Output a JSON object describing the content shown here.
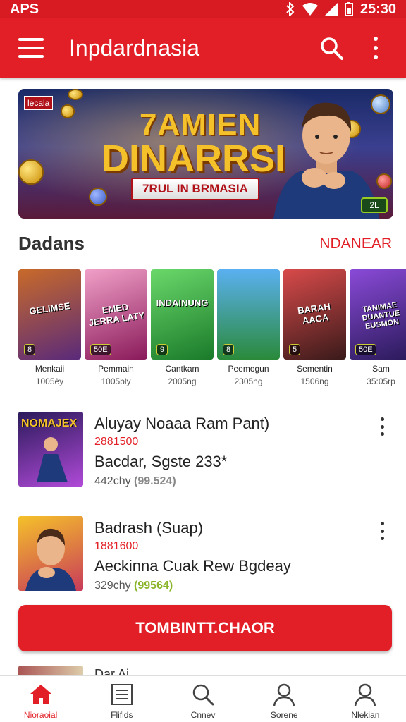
{
  "status_bar": {
    "left_text": "APS",
    "time": "25:30"
  },
  "app_bar": {
    "title": "Inpdardnasia"
  },
  "banner": {
    "tag": "lecala",
    "line1": "7AMIEN",
    "line2": "DINARRSI",
    "ribbon": "7RUL IN BRMASIA",
    "badge": "2L"
  },
  "section": {
    "heading": "Dadans",
    "link": "NDANEAR"
  },
  "cards": [
    {
      "thumb_title": "GELIMSE",
      "chip": "8",
      "name": "Menkaii",
      "sub": "1005ėy",
      "bg": "#5a2a7a"
    },
    {
      "thumb_title": "EMED JERRA LATY",
      "chip": "50E",
      "name": "Pemmain",
      "sub": "1005bly",
      "bg": "#c24a8a"
    },
    {
      "thumb_title": "INDAINUNG",
      "chip": "9",
      "name": "Cantkam",
      "sub": "2005ng",
      "bg": "#2ea83a"
    },
    {
      "thumb_title": "",
      "chip": "8",
      "name": "Peemogun",
      "sub": "2305ng",
      "bg": "#3a8ad8"
    },
    {
      "thumb_title": "BARAH AACA",
      "chip": "5",
      "name": "Sementin",
      "sub": "1506ng",
      "bg": "#8a2a1a"
    },
    {
      "thumb_title": "TANIMAE DUANTUE EUSMON",
      "chip": "50E",
      "name": "Sam",
      "sub": "35:05rp",
      "bg": "#5a3aa8"
    }
  ],
  "list": [
    {
      "thumb_title": "NOMAJEX",
      "title": "Aluyay Noaaa Ram Pant)",
      "id": "2881500",
      "subtitle": "Bacdar, Sgste 233*",
      "meta": "442chy",
      "price": "(99.524)",
      "price_color": "#888888"
    },
    {
      "thumb_title": "",
      "title": "Badrash (Suap)",
      "id": "1881600",
      "subtitle": "Aeckinna Cuak Rew Bgdeay",
      "meta": "329chy",
      "price": "(99564)",
      "price_color": "#8ab52a"
    }
  ],
  "cta": {
    "label": "TOMBINTT.CHAOR"
  },
  "peek": {
    "text": "Dar Ai"
  },
  "bottom_nav": [
    {
      "label": "Nioraoial",
      "icon": "home-icon",
      "active": true
    },
    {
      "label": "Flifids",
      "icon": "list-icon",
      "active": false
    },
    {
      "label": "Cnnev",
      "icon": "search-icon",
      "active": false
    },
    {
      "label": "Sorene",
      "icon": "person-icon",
      "active": false
    },
    {
      "label": "Nlekian",
      "icon": "profile-icon",
      "active": false
    }
  ],
  "colors": {
    "primary": "#e21f26",
    "status_bar": "#d81b22"
  }
}
